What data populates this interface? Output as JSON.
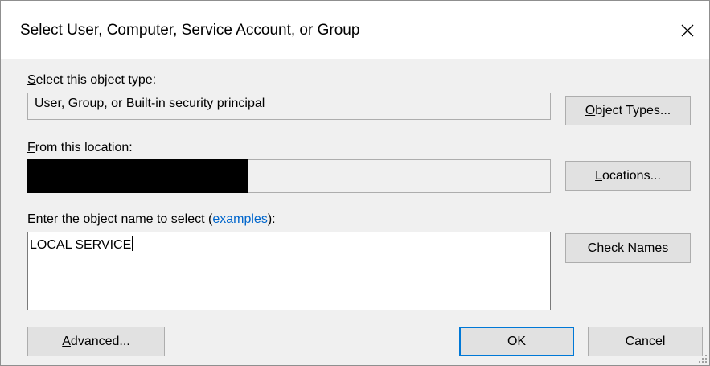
{
  "dialog": {
    "title": "Select User, Computer, Service Account, or Group"
  },
  "object_type": {
    "label_mnemonic": "S",
    "label_rest": "elect this object type:",
    "value": "User, Group, or Built-in security principal",
    "button_mnemonic": "O",
    "button_rest": "bject Types..."
  },
  "location": {
    "label_mnemonic": "F",
    "label_rest": "rom this location:",
    "value": "",
    "button_mnemonic": "L",
    "button_rest": "ocations..."
  },
  "object_name": {
    "label_mnemonic": "E",
    "label_rest": "nter the object name to select (",
    "link": "examples",
    "label_end": "):",
    "value": "LOCAL SERVICE",
    "button_mnemonic": "C",
    "button_rest": "heck Names"
  },
  "footer": {
    "advanced_mnemonic": "A",
    "advanced_rest": "dvanced...",
    "ok": "OK",
    "cancel": "Cancel"
  },
  "icons": {
    "close": "close-icon",
    "resize": "resize-grip-icon"
  },
  "colors": {
    "default_button_border": "#0078d7",
    "link": "#0066cc"
  }
}
